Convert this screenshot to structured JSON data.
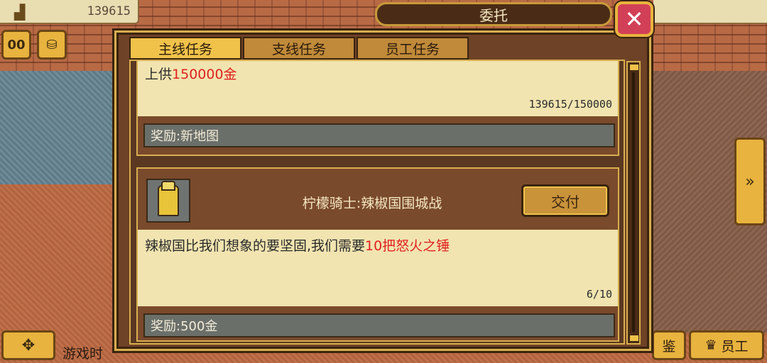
{
  "hud": {
    "gold_value": "139615",
    "pause_label": "00",
    "gold_icon": "buildings-icon",
    "coins_icon": "coins-icon",
    "play_time_label": "游戏时"
  },
  "bottom_bar": {
    "left_icon": "dpad-icon",
    "guide_label": "鉴",
    "staff_label": "员工"
  },
  "modal": {
    "title": "委托",
    "close_label": "✕",
    "tabs": [
      {
        "label": "主线任务",
        "active": true
      },
      {
        "label": "支线任务",
        "active": false
      },
      {
        "label": "员工任务",
        "active": false
      }
    ]
  },
  "quests": [
    {
      "desc_prefix": "上供",
      "desc_highlight": "150000金",
      "desc_suffix": "",
      "progress": "139615/150000",
      "reward": "奖励:新地图"
    },
    {
      "name": "柠檬骑士:辣椒国围城战",
      "deliver_label": "交付",
      "desc_prefix": "辣椒国比我们想象的要坚固,我们需要",
      "desc_highlight": "10把怒火之锤",
      "desc_suffix": "",
      "progress": "6/10",
      "reward": "奖励:500金"
    }
  ],
  "colors": {
    "gold_button": "#e8b33e",
    "highlight_red": "#e02020",
    "close_red": "#d24057"
  }
}
